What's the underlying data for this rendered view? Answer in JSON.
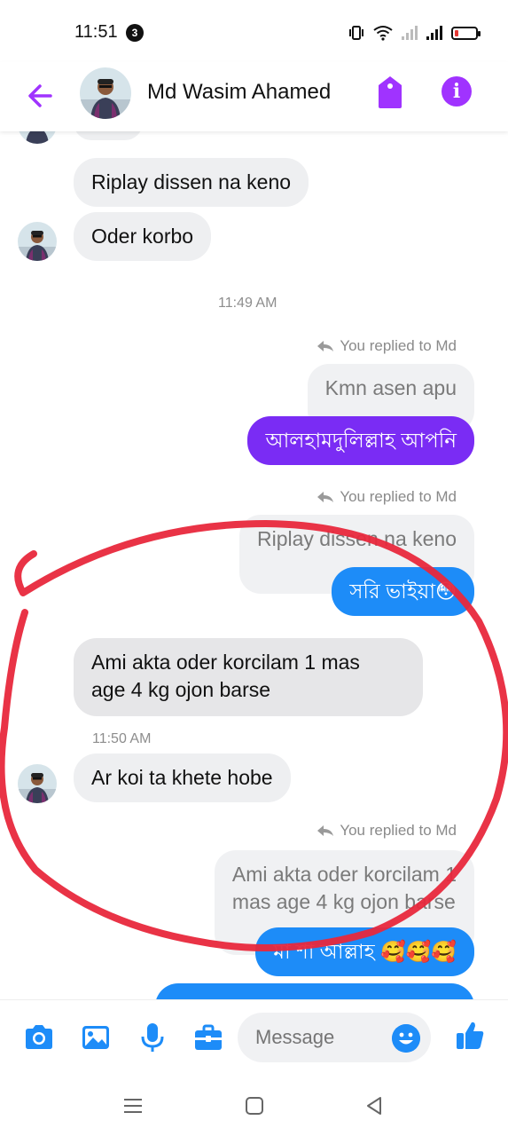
{
  "status_bar": {
    "time": "11:51",
    "notification_count": "3"
  },
  "header": {
    "contact_name": "Md Wasim Ahamed"
  },
  "messages": {
    "m1": "Riplay dissen na keno",
    "m2": "Oder korbo",
    "t1": "11:49 AM",
    "r1_label": "You replied to Md",
    "r1_quote": "Kmn asen apu",
    "r1_reply": "আলহামদুলিল্লাহ আপনি",
    "r2_label": "You replied to Md",
    "r2_quote": "Riplay dissen na keno",
    "r2_reply": "সরি ভাইয়া😳",
    "m3_line1": "Ami akta oder korcilam 1 mas",
    "m3_line2": "age 4 kg ojon barse",
    "t2": "11:50 AM",
    "m4": "Ar koi ta khete hobe",
    "r3_label": "You replied to Md",
    "r3_quote_line1": "Ami akta oder korcilam 1",
    "r3_quote_line2": "mas age 4 kg ojon barse",
    "r3_reply": "মা শা আল্লাহ 🥰🥰🥰"
  },
  "composer": {
    "placeholder": "Message"
  },
  "colors": {
    "accent_purple": "#a033ff",
    "sent_purple": "#7a2cf4",
    "sent_blue": "#1d8cf8",
    "annotation_red": "#e8283c"
  },
  "icons": [
    "back-arrow-icon",
    "tag-icon",
    "info-icon",
    "camera-icon",
    "gallery-icon",
    "microphone-icon",
    "toolbox-icon",
    "emoji-icon",
    "thumbs-up-icon",
    "menu-nav-icon",
    "home-nav-icon",
    "back-nav-icon"
  ]
}
